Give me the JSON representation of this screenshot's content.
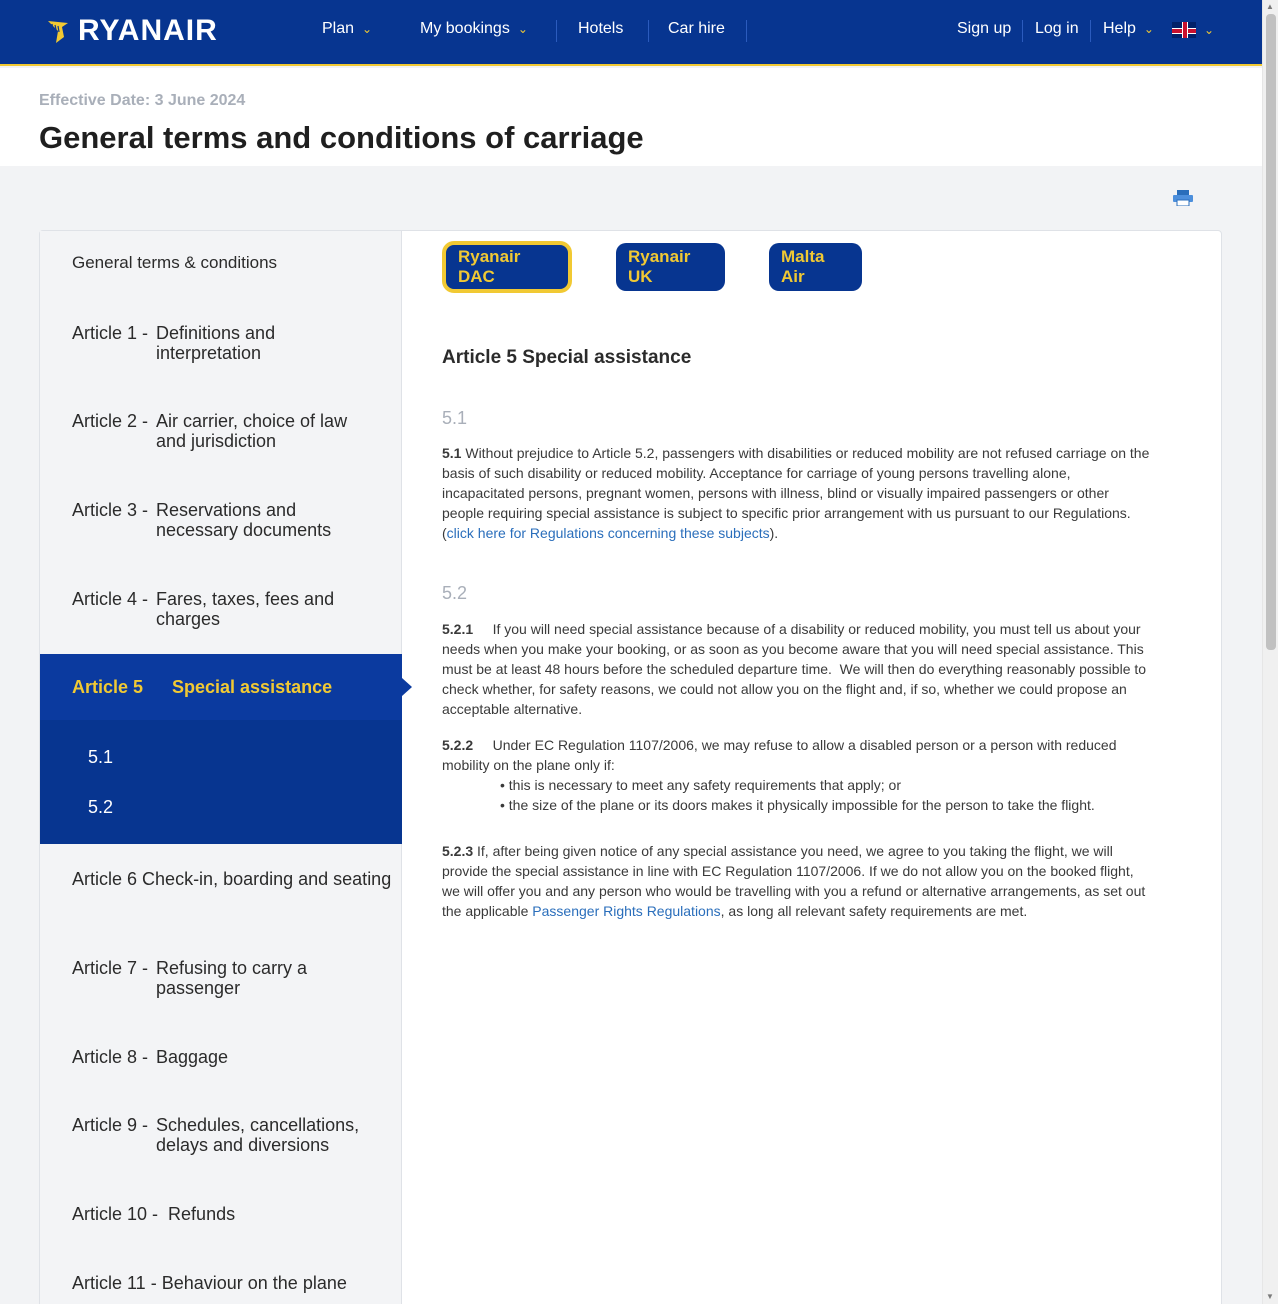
{
  "brand": {
    "name": "RYANAIR",
    "primary": "#073590",
    "accent": "#f1c933"
  },
  "nav": {
    "items": [
      "Plan",
      "My bookings",
      "Hotels",
      "Car hire"
    ],
    "sign_up": "Sign up",
    "log_in": "Log in",
    "help": "Help",
    "language_flag": "uk-flag-icon"
  },
  "header": {
    "effective_date": "Effective Date: 3 June 2024",
    "title": "General terms and conditions of carriage"
  },
  "sidebar": {
    "heading": "General terms & conditions",
    "articles": [
      {
        "num": "Article 1 -",
        "title": "Definitions and interpretation"
      },
      {
        "num": "Article 2 -",
        "title": "Air carrier, choice of law and jurisdiction"
      },
      {
        "num": "Article 3 -",
        "title": "Reservations and necessary documents"
      },
      {
        "num": "Article 4 -",
        "title": "Fares, taxes, fees and charges"
      },
      {
        "num": "Article 5",
        "title": "Special assistance"
      },
      {
        "num": "Article 6",
        "title": "Check-in, boarding and seating"
      },
      {
        "num": "Article 7 -",
        "title": "Refusing to carry a passenger"
      },
      {
        "num": "Article 8 -",
        "title": "Baggage"
      },
      {
        "num": "Article 9 -",
        "title": "Schedules, cancellations, delays and diversions"
      },
      {
        "num": "Article 10 -",
        "title": "Refunds"
      },
      {
        "num": "Article 11 -",
        "title": "Behaviour on the plane"
      }
    ],
    "sub_items": [
      "5.1",
      "5.2"
    ]
  },
  "carriers": [
    "Ryanair DAC",
    "Ryanair UK",
    "Malta Air"
  ],
  "content": {
    "heading": "Article 5  Special assistance",
    "s51": {
      "num": "5.1",
      "bold": "5.1",
      "text": " Without prejudice to Article 5.2, passengers with disabilities or reduced mobility are not refused carriage on the basis of such disability or reduced mobility.  Acceptance for carriage of young persons travelling alone, incapacitated persons, pregnant women, persons with illness, blind or visually impaired passengers or other people requiring special assistance is subject to specific prior arrangement with us pursuant to our Regulations. (",
      "link": "click here for Regulations concerning  these subjects",
      "after": ")."
    },
    "s52": {
      "num": "5.2",
      "p1_bold": "5.2.1",
      "p1": "     If you will need special assistance because of a disability or reduced mobility, you must tell us about your needs when you make your booking, or as soon as you become aware that you will need special assistance. This must be at least 48 hours before the scheduled departure time.  We will then do everything reasonably possible to check whether, for safety reasons, we could not allow you on the flight and, if so, whether we could propose an acceptable alternative.",
      "p2_bold": "5.2.2",
      "p2": "     Under EC Regulation 1107/2006, we may refuse to allow a disabled person or a person with reduced mobility on the plane only if:",
      "bullets": [
        "this is necessary to meet any safety requirements that apply; or",
        "the size of the plane or its doors makes it physically impossible for the person to take the flight."
      ],
      "p3_bold": "5.2.3",
      "p3": " If, after being given notice of any special assistance you need, we agree to you taking the flight, we will provide the special assistance in line with EC Regulation 1107/2006. If we do not allow you on the booked flight, we will offer you and any person who would be travelling with you a refund or alternative arrangements, as set out the applicable ",
      "p3_link": "Passenger Rights Regulations",
      "p3_after": ", as long all relevant safety requirements are met."
    }
  }
}
